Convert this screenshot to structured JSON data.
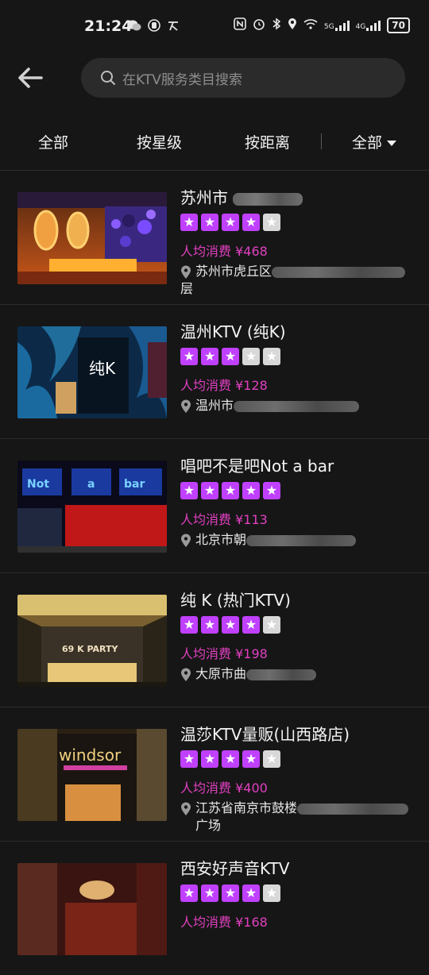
{
  "status": {
    "time": "21:24",
    "battery": "70",
    "net1": "5G",
    "net2": "4G"
  },
  "search": {
    "placeholder": "在KTV服务类目搜索"
  },
  "filters": [
    "全部",
    "按星级",
    "按距离",
    "全部"
  ],
  "colors": {
    "star_on": "#c040ff",
    "star_off": "#d8d8d8",
    "price": "#e040c0",
    "background": "#161616"
  },
  "items": [
    {
      "name": "苏州市",
      "rating": 4,
      "price": "人均消费 ¥468",
      "address": "苏州市虎丘区",
      "address_cont": "层"
    },
    {
      "name": "温州KTV (纯K)",
      "rating": 3,
      "price": "人均消费 ¥128",
      "address": "温州市",
      "address_cont": ""
    },
    {
      "name": "唱吧不是吧Not a bar",
      "rating": 5,
      "price": "人均消费 ¥113",
      "address": "北京市朝",
      "address_cont": ""
    },
    {
      "name": "纯 K (热门KTV)",
      "rating": 4,
      "price": "人均消费 ¥198",
      "address": "大原市曲",
      "address_cont": ""
    },
    {
      "name": "温莎KTV量贩(山西路店)",
      "rating": 4,
      "price": "人均消费 ¥400",
      "address": "江苏省南京市鼓楼",
      "address_cont": "广场"
    },
    {
      "name": "西安好声音KTV",
      "rating": 4,
      "price": "人均消费 ¥168",
      "address": "",
      "address_cont": ""
    }
  ],
  "thumb_text": {
    "item2": "纯K",
    "item3": [
      "Not",
      "a",
      "bar"
    ],
    "item4": "69 K PARTY",
    "item5": "windsor"
  }
}
